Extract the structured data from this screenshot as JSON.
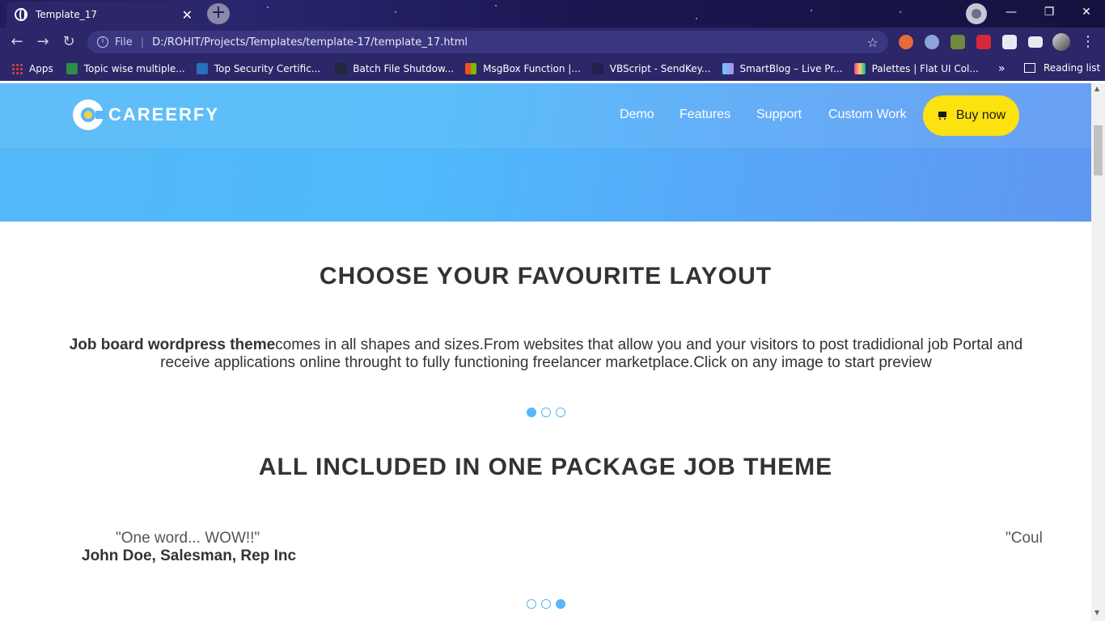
{
  "browser": {
    "tab_title": "Template_17",
    "omnibox_prefix": "File",
    "url": "D:/ROHIT/Projects/Templates/template-17/template_17.html",
    "bookmarks": [
      {
        "label": "Apps"
      },
      {
        "label": "Topic wise multiple..."
      },
      {
        "label": "Top Security Certific..."
      },
      {
        "label": "Batch File Shutdow..."
      },
      {
        "label": "MsgBox Function |..."
      },
      {
        "label": "VBScript - SendKey..."
      },
      {
        "label": "SmartBlog – Live Pr..."
      },
      {
        "label": "Palettes | Flat UI Col..."
      }
    ],
    "reading_list": "Reading list"
  },
  "site": {
    "logo_text": "CAREERFY",
    "nav": [
      "Demo",
      "Features",
      "Support",
      "Custom Work"
    ],
    "buy_label": "Buy now"
  },
  "layout_section": {
    "title": "CHOOSE YOUR FAVOURITE LAYOUT",
    "intro_bold": "Job board wordpress theme",
    "intro_text": "comes in all shapes and sizes.From websites that allow you and your visitors to post tradidional job Portal and receive applications online throught to fully functioning freelancer marketplace.Click on any image to start preview",
    "carousel_active_index": 0
  },
  "package_section": {
    "title": "ALL INCLUDED IN ONE PACKAGE JOB THEME",
    "testimonial_quote": "\"One word... WOW!!\"",
    "testimonial_author": "John Doe, Salesman, Rep Inc",
    "next_quote_partial": "\"Coul",
    "carousel_active_index": 2
  }
}
